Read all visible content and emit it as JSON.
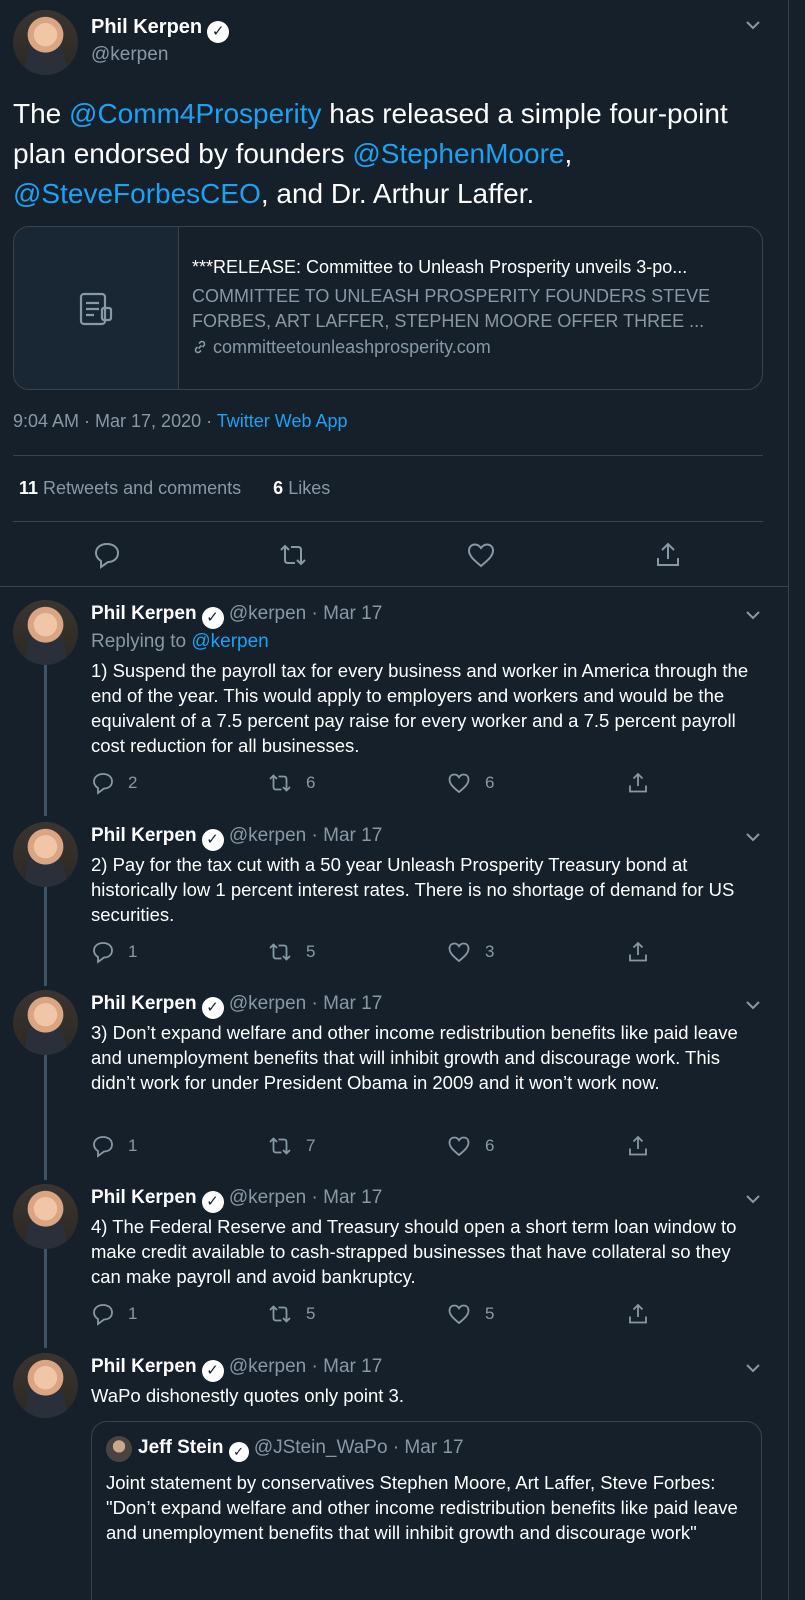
{
  "main": {
    "name": "Phil Kerpen",
    "handle": "@kerpen",
    "text_1": "The ",
    "mention_1": "@Comm4Prosperity",
    "text_2": " has released a simple four-point plan endorsed by founders ",
    "mention_2": "@StephenMoore",
    "text_3": ", ",
    "mention_3": "@SteveForbesCEO",
    "text_4": ", and Dr. Arthur Laffer.",
    "card": {
      "title": "***RELEASE: Committee to Unleash Prosperity unveils 3-po...",
      "description": "COMMITTEE TO UNLEASH PROSPERITY FOUNDERS STEVE FORBES, ART LAFFER, STEPHEN MOORE OFFER THREE ...",
      "domain": "committeetounleashprosperity.com"
    },
    "time": "9:04 AM · Mar 17, 2020 · ",
    "source": "Twitter Web App",
    "retweets_count": "11",
    "retweets_label": "Retweets and comments",
    "likes_count": "6",
    "likes_label": "Likes"
  },
  "replies": [
    {
      "name": "Phil Kerpen",
      "handle_date": "@kerpen · Mar 17",
      "replying_prefix": "Replying to ",
      "replying_to": "@kerpen",
      "text": "1) Suspend the payroll tax for every business and worker in America through the end of the year. This would apply to employers and workers and would be the equivalent of a 7.5 percent pay raise for every worker and a 7.5 percent payroll cost reduction for all businesses.",
      "replies": "2",
      "retweets": "6",
      "likes": "6"
    },
    {
      "name": "Phil Kerpen",
      "handle_date": "@kerpen · Mar 17",
      "text": "2) Pay for the tax cut with a 50 year Unleash Prosperity Treasury bond at historically low 1 percent interest rates. There is no shortage of demand for US securities.",
      "replies": "1",
      "retweets": "5",
      "likes": "3"
    },
    {
      "name": "Phil Kerpen",
      "handle_date": "@kerpen · Mar 17",
      "text": "3) Don’t expand welfare and other income redistribution benefits like paid leave and unemployment benefits that will inhibit growth and discourage work. This didn’t work for under President Obama in 2009 and it won’t work now.",
      "replies": "1",
      "retweets": "7",
      "likes": "6"
    },
    {
      "name": "Phil Kerpen",
      "handle_date": "@kerpen · Mar 17",
      "text": "4) The Federal Reserve and Treasury should open a short term loan window to make credit available to cash-strapped businesses that have collateral so they can make payroll and avoid bankruptcy.",
      "replies": "1",
      "retweets": "5",
      "likes": "5"
    },
    {
      "name": "Phil Kerpen",
      "handle_date": "@kerpen · Mar 17",
      "text": "WaPo dishonestly quotes only point 3."
    }
  ],
  "quote": {
    "name": "Jeff Stein",
    "handle_date": "@JStein_WaPo · Mar 17",
    "text": "Joint statement by conservatives Stephen Moore, Art Laffer, Steve Forbes: \"Don’t expand welfare and other income redistribution benefits like paid leave and unemployment benefits that will inhibit growth and discourage work\""
  },
  "colors": {
    "background": "#15202b",
    "accent": "#1da1f2",
    "secondary_text": "#8899a6",
    "border": "#38444d"
  }
}
